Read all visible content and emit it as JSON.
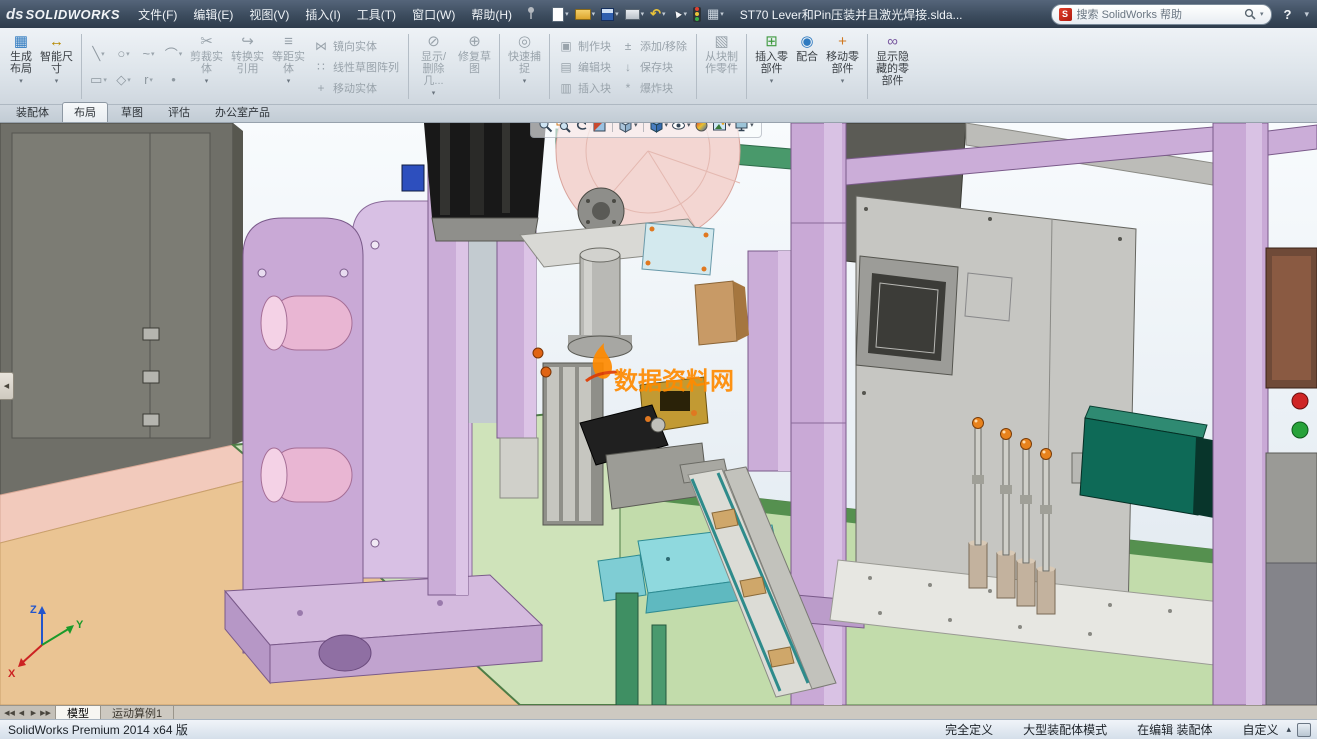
{
  "titlebar": {
    "logo": {
      "prefix": "ds",
      "text": "SOLIDWORKS"
    },
    "menus": [
      "文件(F)",
      "编辑(E)",
      "视图(V)",
      "插入(I)",
      "工具(T)",
      "窗口(W)",
      "帮助(H)"
    ],
    "document_title": "ST70 Lever和Pin压装并且激光焊接.slda...",
    "search": {
      "placeholder": "搜索 SolidWorks 帮助"
    },
    "help_label": "?"
  },
  "ribbon": {
    "create_layout": "生成布局",
    "smart_dimension": "智能尺寸",
    "trim_entities": "剪裁实体",
    "convert_entities": "转换实引用",
    "offset_entities": "等距实体",
    "mirror_entities": "镜向实体",
    "linear_sketch_pattern": "线性草图阵列",
    "move_entities": "移动实体",
    "display_delete_relations": "显示/删除几...",
    "repair_sketch": "修复草图",
    "quick_snaps": "快速捕捉",
    "make_block": "制作块",
    "edit_block": "编辑块",
    "insert_block": "插入块",
    "add_remove": "添加/移除",
    "save_block": "保存块",
    "explode_block": "爆炸块",
    "make_part_from_block": "从块制作零件",
    "insert_components": "插入零部件",
    "mate": "配合",
    "move_component": "移动零部件",
    "show_hidden_components": "显示隐藏的零部件"
  },
  "command_tabs": {
    "items": [
      "装配体",
      "布局",
      "草图",
      "评估",
      "办公室产品"
    ],
    "active": "布局"
  },
  "viewport": {
    "watermark": "数据资料网",
    "triad": {
      "x": "X",
      "y": "Y",
      "z": "Z"
    },
    "hud_icons": [
      "zoom-fit",
      "zoom-area",
      "previous-view",
      "section-view",
      "view-orientation",
      "display-style",
      "hide-show-items",
      "edit-appearance",
      "apply-scene",
      "view-settings"
    ],
    "accent_colors": {
      "frame": "#c9a9d6",
      "table": "#cfe3ba",
      "watermark": "#ff8a00"
    }
  },
  "model_tabs": {
    "items": [
      "模型",
      "运动算例1"
    ],
    "active": "模型"
  },
  "statusbar": {
    "left": "SolidWorks Premium 2014 x64 版",
    "items": [
      "完全定义",
      "大型装配体模式",
      "在编辑 装配体",
      "自定义"
    ]
  }
}
